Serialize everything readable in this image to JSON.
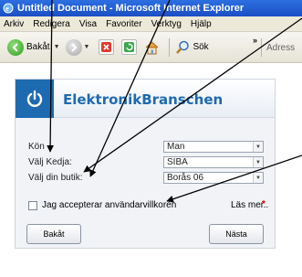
{
  "window": {
    "title": "Untitled Document - Microsoft Internet Explorer"
  },
  "menu": {
    "items": [
      "Arkiv",
      "Redigera",
      "Visa",
      "Favoriter",
      "Verktyg",
      "Hjälp"
    ]
  },
  "toolbar": {
    "back_label": "Bakåt",
    "search_label": "Sök",
    "address_label": "Adress",
    "overflow": "»",
    "icons": [
      "back-arrow-icon",
      "forward-arrow-icon",
      "stop-icon",
      "refresh-icon",
      "home-icon",
      "search-icon"
    ]
  },
  "colors": {
    "brand": "#1e6ab0",
    "titlebar": "#1b4fc4",
    "required": "#d40000"
  },
  "form": {
    "brand": "ElektronikBranschen",
    "fields": [
      {
        "label": "Kön",
        "value": "Man"
      },
      {
        "label": "Välj Kedja:",
        "value": "SIBA"
      },
      {
        "label": "Välj din butik:",
        "value": "Borås 06"
      }
    ],
    "terms": {
      "label": "Jag accepterar användarvillkoren",
      "checked": false,
      "read_more": "Läs mer..",
      "required_mark": "*"
    },
    "back_button": "Bakåt",
    "next_button": "Nästa"
  }
}
